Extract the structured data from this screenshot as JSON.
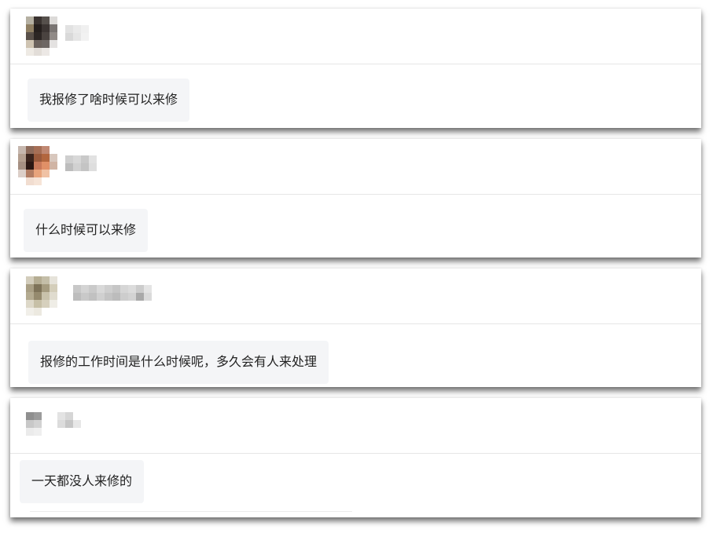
{
  "comments": [
    {
      "message": "我报修了啥时候可以来修"
    },
    {
      "message": "什么时候可以来修"
    },
    {
      "message": "报修的工作时间是什么时候呢，多久会有人来处理"
    },
    {
      "message": "一天都没人来修的"
    }
  ]
}
